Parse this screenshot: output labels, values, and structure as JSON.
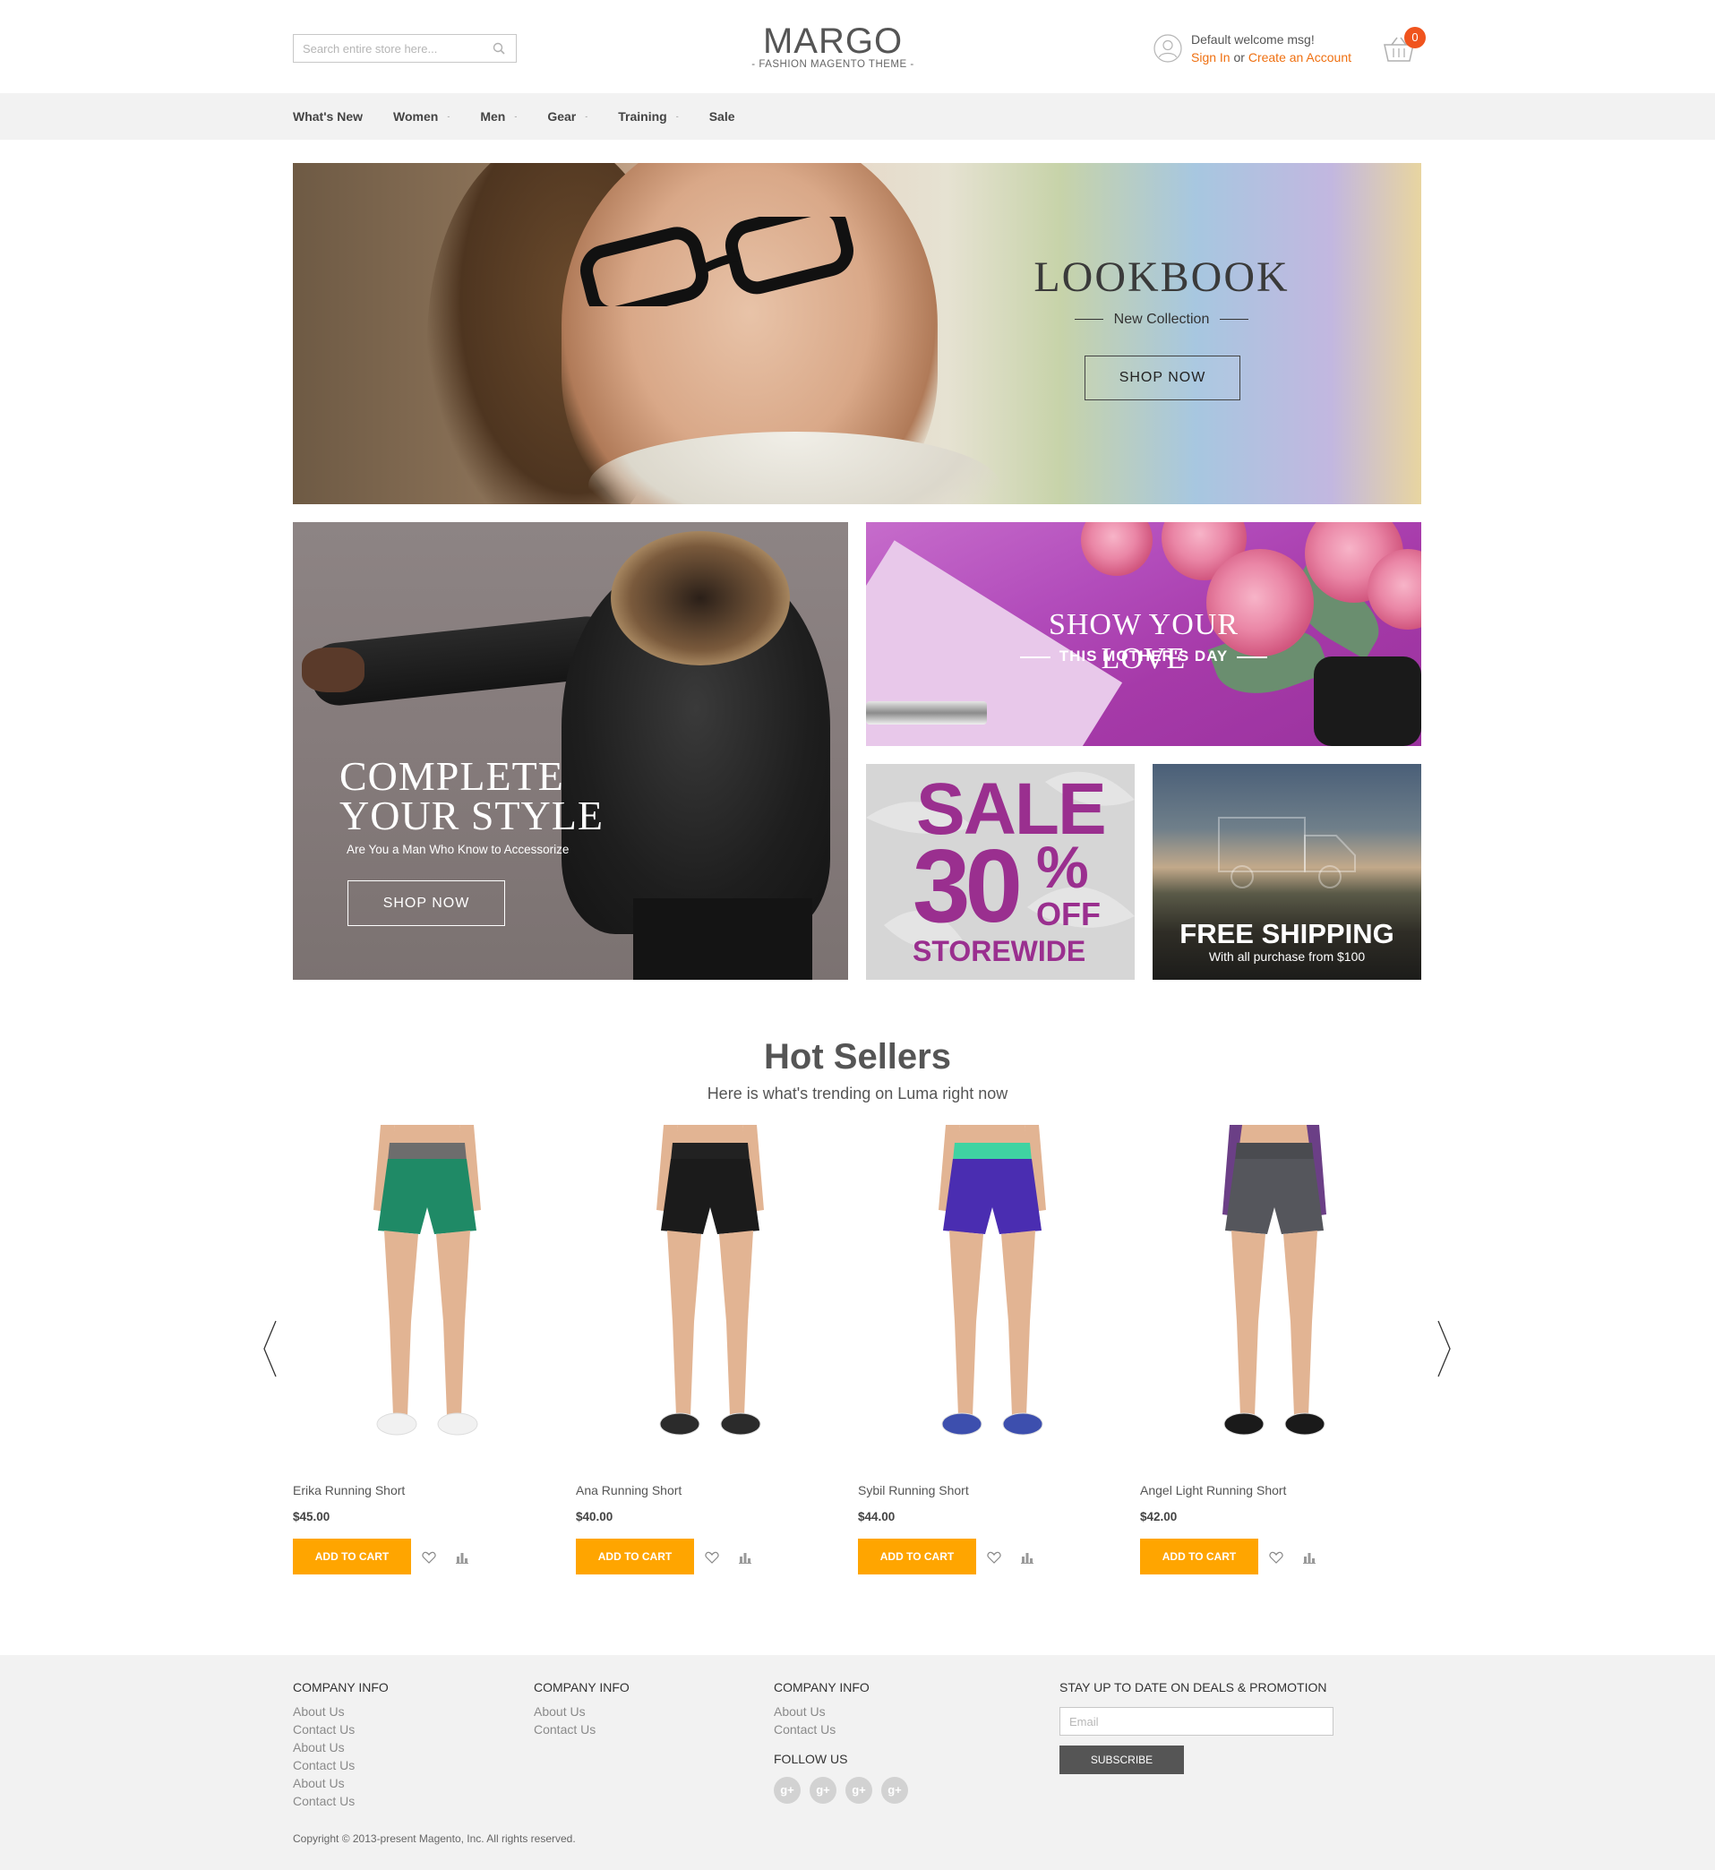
{
  "header": {
    "search": {
      "placeholder": "Search entire store here..."
    },
    "logo": {
      "title": "MARGO",
      "subtitle": "- FASHION MAGENTO THEME -"
    },
    "account": {
      "welcome": "Default welcome msg!",
      "sign_in": "Sign In",
      "or": "or",
      "create_account": "Create an Account"
    },
    "cart": {
      "count": "0"
    }
  },
  "nav": {
    "items": [
      {
        "label": "What's New",
        "has_dropdown": false
      },
      {
        "label": "Women",
        "has_dropdown": true
      },
      {
        "label": "Men",
        "has_dropdown": true
      },
      {
        "label": "Gear",
        "has_dropdown": true
      },
      {
        "label": "Training",
        "has_dropdown": true
      },
      {
        "label": "Sale",
        "has_dropdown": false
      }
    ],
    "dropdown_glyph": "-"
  },
  "banners": {
    "hero": {
      "title": "LOOKBOOK",
      "subtitle": "New Collection",
      "button": "SHOP NOW"
    },
    "style": {
      "title_line1": "COMPLETE",
      "title_line2": "YOUR STYLE",
      "subtitle": "Are You a Man Who Know to Accessorize",
      "button": "SHOP NOW"
    },
    "love": {
      "title": "SHOW YOUR LOVE",
      "subtitle": "THIS MOTHER'S DAY"
    },
    "sale": {
      "line1": "SALE",
      "number": "30",
      "percent": "%",
      "off": "OFF",
      "line3": "STOREWIDE"
    },
    "shipping": {
      "title": "FREE SHIPPING",
      "subtitle": "With all purchase from $100"
    }
  },
  "hot_sellers": {
    "title": "Hot Sellers",
    "subtitle": "Here is what's trending on Luma right now",
    "add_to_cart_label": "ADD TO CART",
    "products": [
      {
        "name": "Erika Running Short",
        "price": "$45.00",
        "short_color": "#1f8a66",
        "waist_color": "#6d6d6d",
        "shoe_color": "#f1f1f1",
        "top_color": ""
      },
      {
        "name": "Ana Running Short",
        "price": "$40.00",
        "short_color": "#1b1b1b",
        "waist_color": "#222222",
        "shoe_color": "#2b2b2b",
        "top_color": ""
      },
      {
        "name": "Sybil Running Short",
        "price": "$44.00",
        "short_color": "#4a2db1",
        "waist_color": "#3fd3a2",
        "shoe_color": "#3d4fae",
        "top_color": ""
      },
      {
        "name": "Angel Light Running Short",
        "price": "$42.00",
        "short_color": "#55565c",
        "waist_color": "#4a4b50",
        "shoe_color": "#1a1a1a",
        "top_color": "#6b3f86"
      }
    ]
  },
  "footer": {
    "columns": [
      {
        "heading": "COMPANY INFO",
        "links": [
          "About Us",
          "Contact Us",
          "About Us",
          "Contact Us",
          "About Us",
          "Contact Us"
        ]
      },
      {
        "heading": "COMPANY INFO",
        "links": [
          "About Us",
          "Contact Us"
        ]
      },
      {
        "heading": "COMPANY INFO",
        "links": [
          "About Us",
          "Contact Us"
        ]
      }
    ],
    "follow_us": "FOLLOW US",
    "social_glyph": "g+",
    "social_count": 4,
    "newsletter": {
      "heading": "STAY UP TO DATE ON DEALS & PROMOTION",
      "placeholder": "Email",
      "button": "SUBSCRIBE"
    },
    "copyright": "Copyright © 2013-present Magento, Inc. All rights reserved."
  },
  "colors": {
    "accent_orange": "#ffa500",
    "link_orange": "#ef7011",
    "cart_badge": "#f0541e",
    "sale_purple": "#9a2f8f"
  }
}
